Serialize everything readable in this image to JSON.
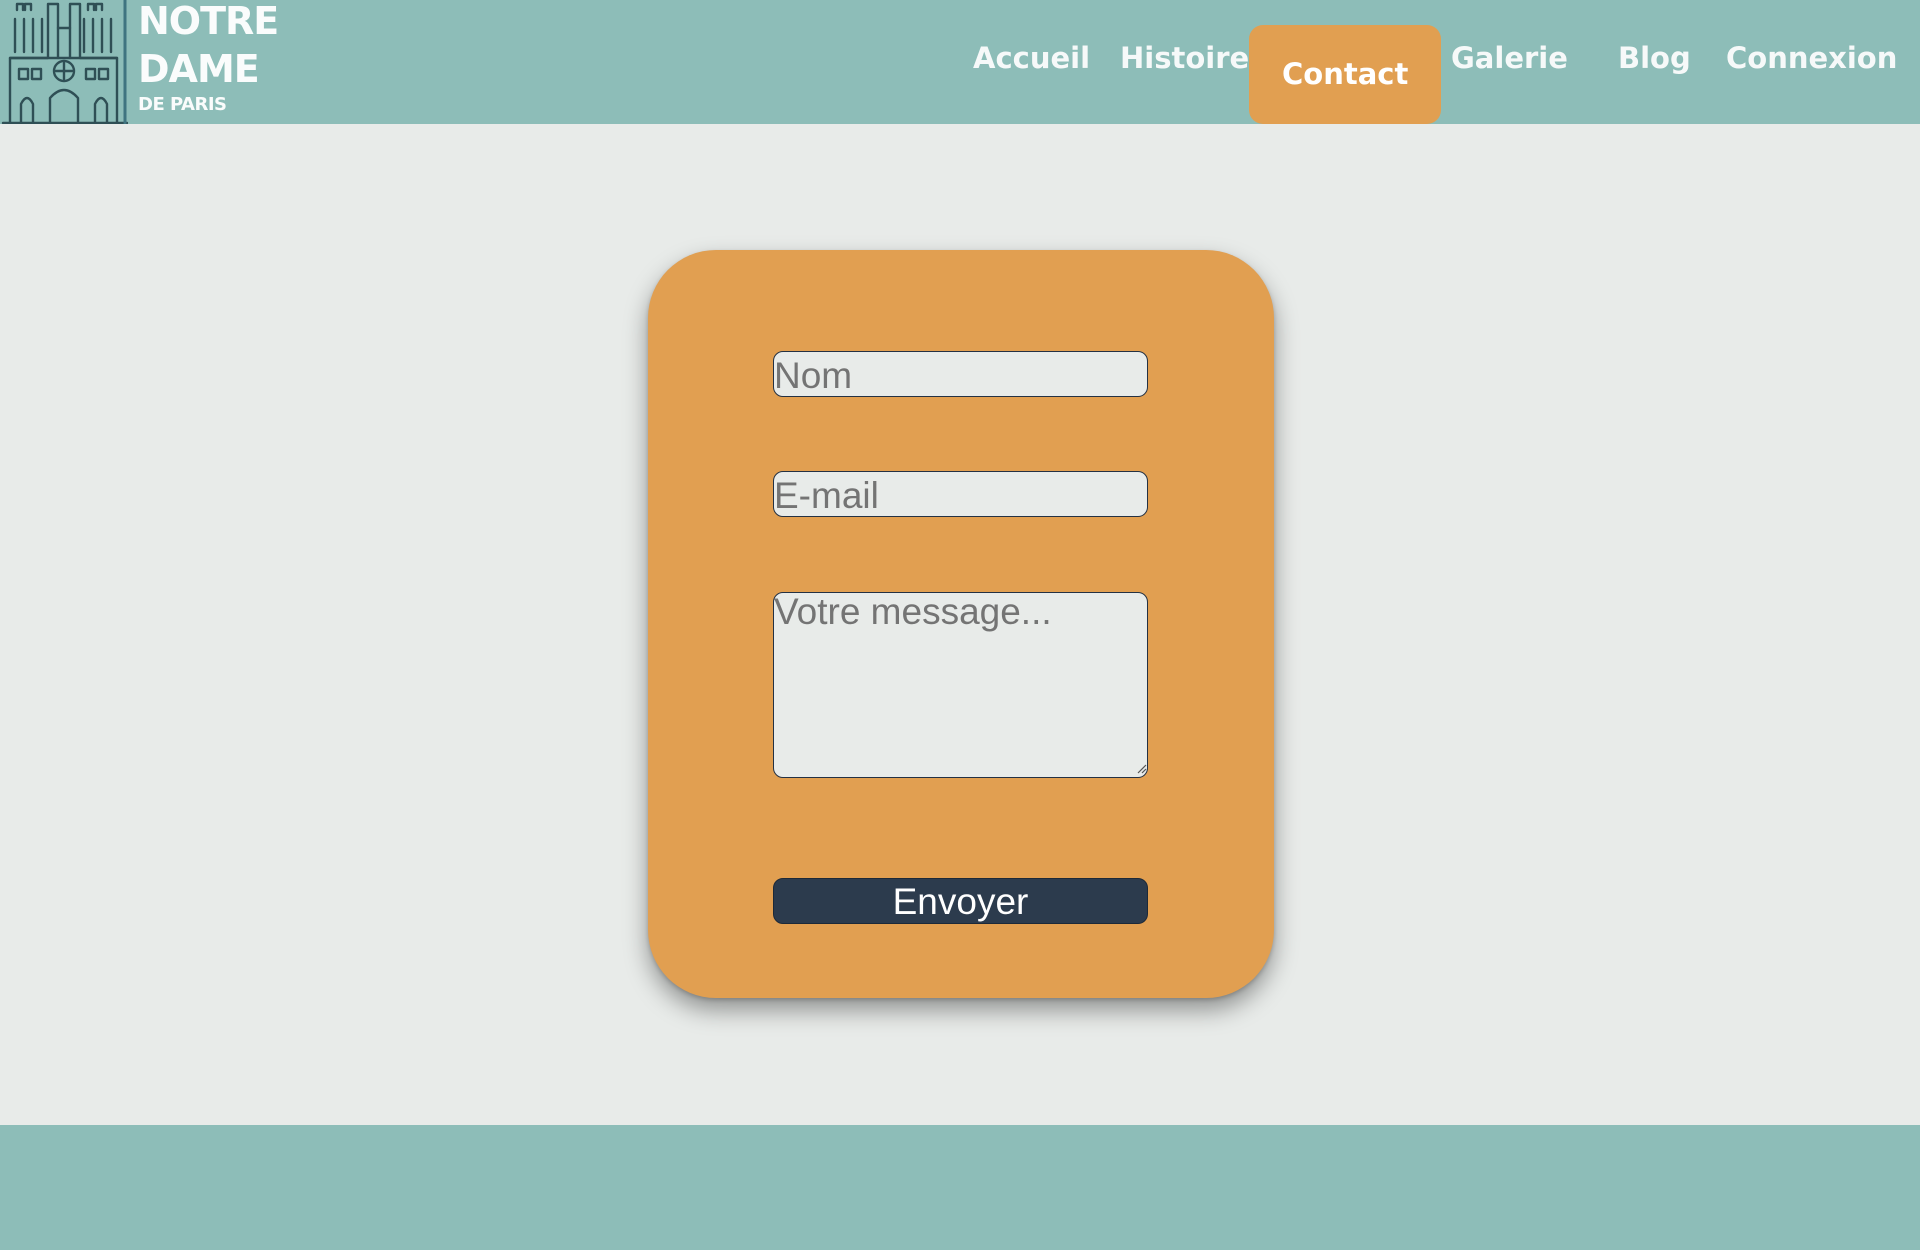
{
  "brand": {
    "line1": "NOTRE",
    "line2": "DAME",
    "line3": "DE PARIS",
    "logo_icon": "notre-dame-cathedral-icon"
  },
  "nav": {
    "items": [
      {
        "label": "Accueil",
        "active": false
      },
      {
        "label": "Histoire",
        "active": false
      },
      {
        "label": "Contact",
        "active": true
      },
      {
        "label": "Galerie",
        "active": false
      },
      {
        "label": "Blog",
        "active": false
      },
      {
        "label": "Connexion",
        "active": false
      }
    ]
  },
  "contact_form": {
    "name_placeholder": "Nom",
    "email_placeholder": "E-mail",
    "message_placeholder": "Votre message...",
    "submit_label": "Envoyer"
  },
  "colors": {
    "header_footer": "#8dbdb8",
    "page_background": "#e8ebe9",
    "accent_orange": "#e19f51",
    "button_navy": "#2c3b4d",
    "logo_line": "#2f4f55"
  },
  "icons": {
    "textarea_resize": "resize-grip-icon"
  }
}
